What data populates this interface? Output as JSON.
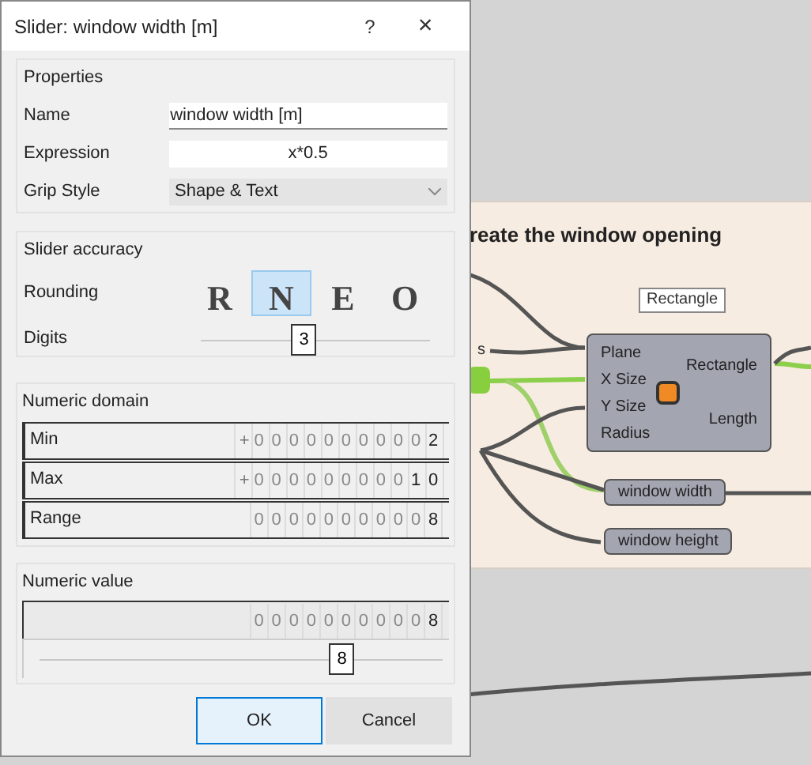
{
  "dialog": {
    "title": "Slider: window width [m]",
    "help": "?",
    "close": "×",
    "properties": {
      "header": "Properties",
      "fields": [
        {
          "label": "Name",
          "value": "window width [m]",
          "kind": "text"
        },
        {
          "label": "Expression",
          "value": "x*0.5",
          "kind": "centered"
        },
        {
          "label": "Grip Style",
          "value": "Shape & Text",
          "kind": "dropdown"
        }
      ]
    },
    "accuracy": {
      "header": "Slider accuracy",
      "rounding_label": "Rounding",
      "rounding": [
        {
          "label": "R",
          "selected": false
        },
        {
          "label": "N",
          "selected": true
        },
        {
          "label": "E",
          "selected": false
        },
        {
          "label": "O",
          "selected": false
        }
      ],
      "digits_label": "Digits",
      "digits": {
        "level": 0.45,
        "thumb": "3"
      }
    },
    "domain": {
      "header": "Numeric domain",
      "rows": [
        {
          "label": "Min",
          "sign": "+",
          "leading": "0000000000",
          "value": "2"
        },
        {
          "label": "Max",
          "sign": "+",
          "leading": "000000000",
          "value": "10"
        },
        {
          "label": "Range",
          "leading": "0000000000",
          "value": "8"
        }
      ]
    },
    "numeric_value": {
      "header": "Numeric value",
      "leading": "0000000000",
      "value": "8",
      "slider": {
        "level": 0.75,
        "thumb": "8"
      }
    },
    "buttons": [
      {
        "label": "OK",
        "selected": true
      },
      {
        "label": "Cancel",
        "selected": false
      }
    ]
  },
  "canvas": {
    "group_title": "reate the window opening",
    "fragment": "s",
    "tooltip": "Rectangle",
    "component": {
      "inputs": [
        "Plane",
        "X Size",
        "Y Size",
        "Radius"
      ],
      "outputs": [
        "Rectangle",
        "Length"
      ]
    },
    "panels": [
      "window width",
      "window height"
    ]
  }
}
